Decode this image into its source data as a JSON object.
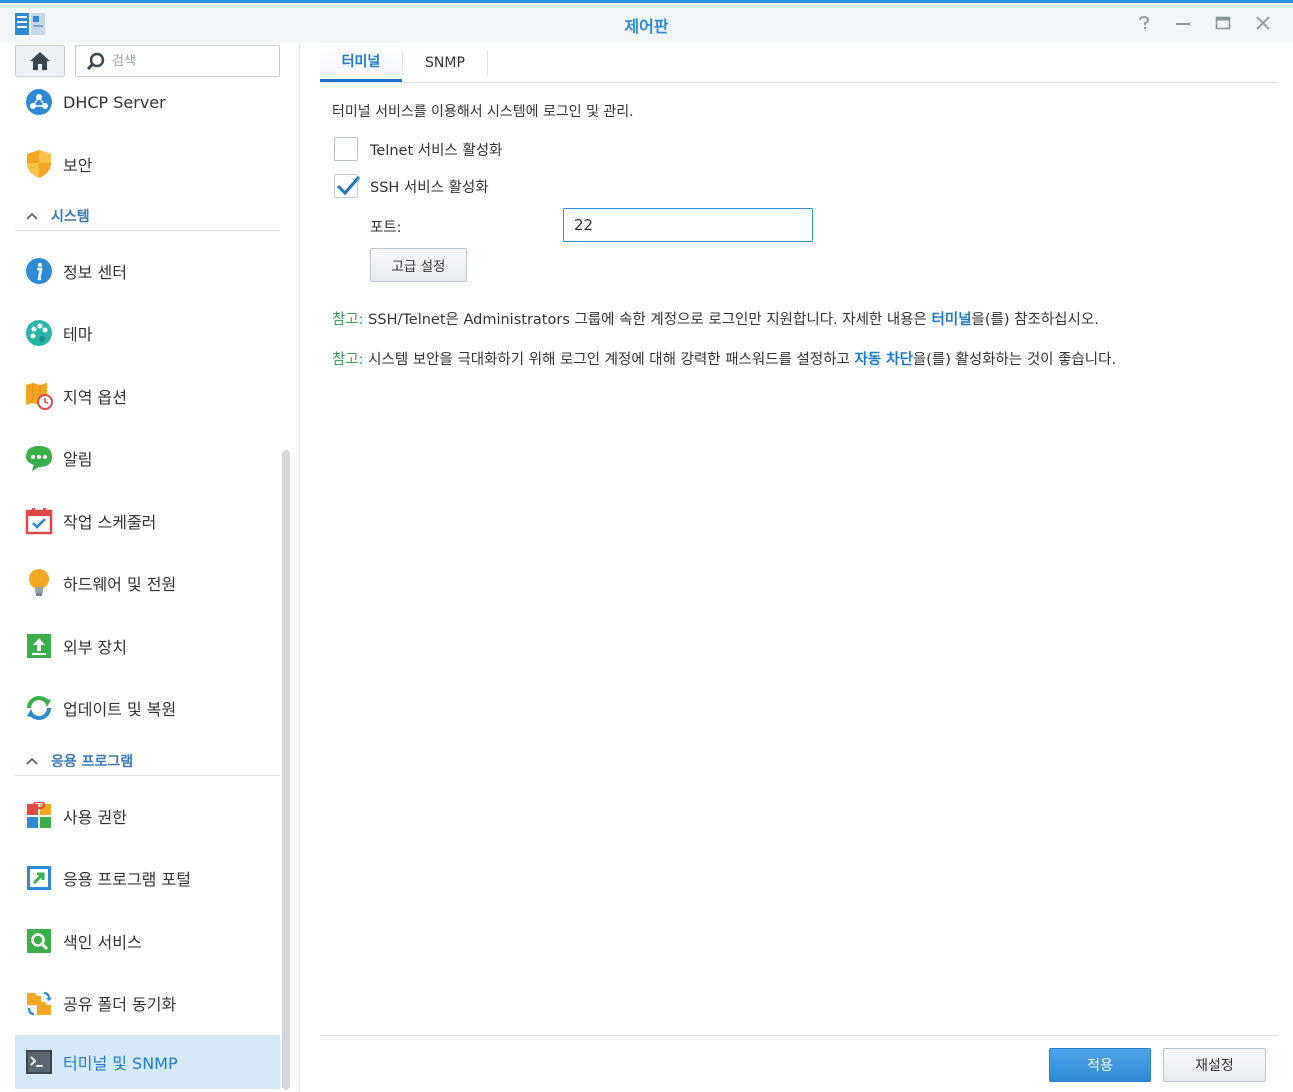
{
  "window": {
    "title": "제어판",
    "controls": [
      "help-icon",
      "minimize-icon",
      "maximize-icon",
      "close-icon"
    ]
  },
  "sidebar": {
    "search_placeholder": "검색",
    "items": [
      {
        "label": "DHCP Server",
        "icon": "dhcp-server-icon"
      },
      {
        "label": "보안",
        "icon": "security-shield-icon"
      },
      {
        "section": "시스템"
      },
      {
        "label": "정보 센터",
        "icon": "info-center-icon"
      },
      {
        "label": "테마",
        "icon": "theme-palette-icon"
      },
      {
        "label": "지역 옵션",
        "icon": "regional-options-icon"
      },
      {
        "label": "알림",
        "icon": "notification-icon"
      },
      {
        "label": "작업 스케줄러",
        "icon": "task-scheduler-icon"
      },
      {
        "label": "하드웨어 및 전원",
        "icon": "hardware-power-icon"
      },
      {
        "label": "외부 장치",
        "icon": "external-devices-icon"
      },
      {
        "label": "업데이트 및 복원",
        "icon": "update-restore-icon"
      },
      {
        "section": "응용 프로그램"
      },
      {
        "label": "사용 권한",
        "icon": "privileges-icon"
      },
      {
        "label": "응용 프로그램 포털",
        "icon": "application-portal-icon"
      },
      {
        "label": "색인 서비스",
        "icon": "indexing-service-icon"
      },
      {
        "label": "공유 폴더 동기화",
        "icon": "shared-folder-sync-icon"
      },
      {
        "label": "터미널 및 SNMP",
        "icon": "terminal-icon",
        "active": true
      }
    ]
  },
  "tabs": [
    {
      "label": "터미널",
      "active": true
    },
    {
      "label": "SNMP",
      "active": false
    }
  ],
  "terminal": {
    "description": "터미널 서비스를 이용해서 시스템에 로그인 및 관리.",
    "telnet_label": "Telnet 서비스 활성화",
    "telnet_checked": false,
    "ssh_label": "SSH 서비스 활성화",
    "ssh_checked": true,
    "port_label": "포트:",
    "port_value": "22",
    "advanced_button": "고급 설정",
    "note1": {
      "key": "참고:",
      "text_before": " SSH/Telnet은 Administrators 그룹에 속한 계정으로 로그인만 지원합니다. 자세한 내용은 ",
      "link": "터미널",
      "text_after": "을(를) 참조하십시오."
    },
    "note2": {
      "key": "참고:",
      "text_before": " 시스템 보안을 극대화하기 위해 로그인 계정에 대해 강력한 패스워드를 설정하고 ",
      "link": "자동 차단",
      "text_after": "을(를) 활성화하는 것이 좋습니다."
    }
  },
  "footer": {
    "apply_label": "적용",
    "reset_label": "재설정"
  },
  "colors": {
    "accent": "#2f8ad6",
    "active_bg": "#d6e9fb",
    "note_key": "#3aa35f"
  }
}
